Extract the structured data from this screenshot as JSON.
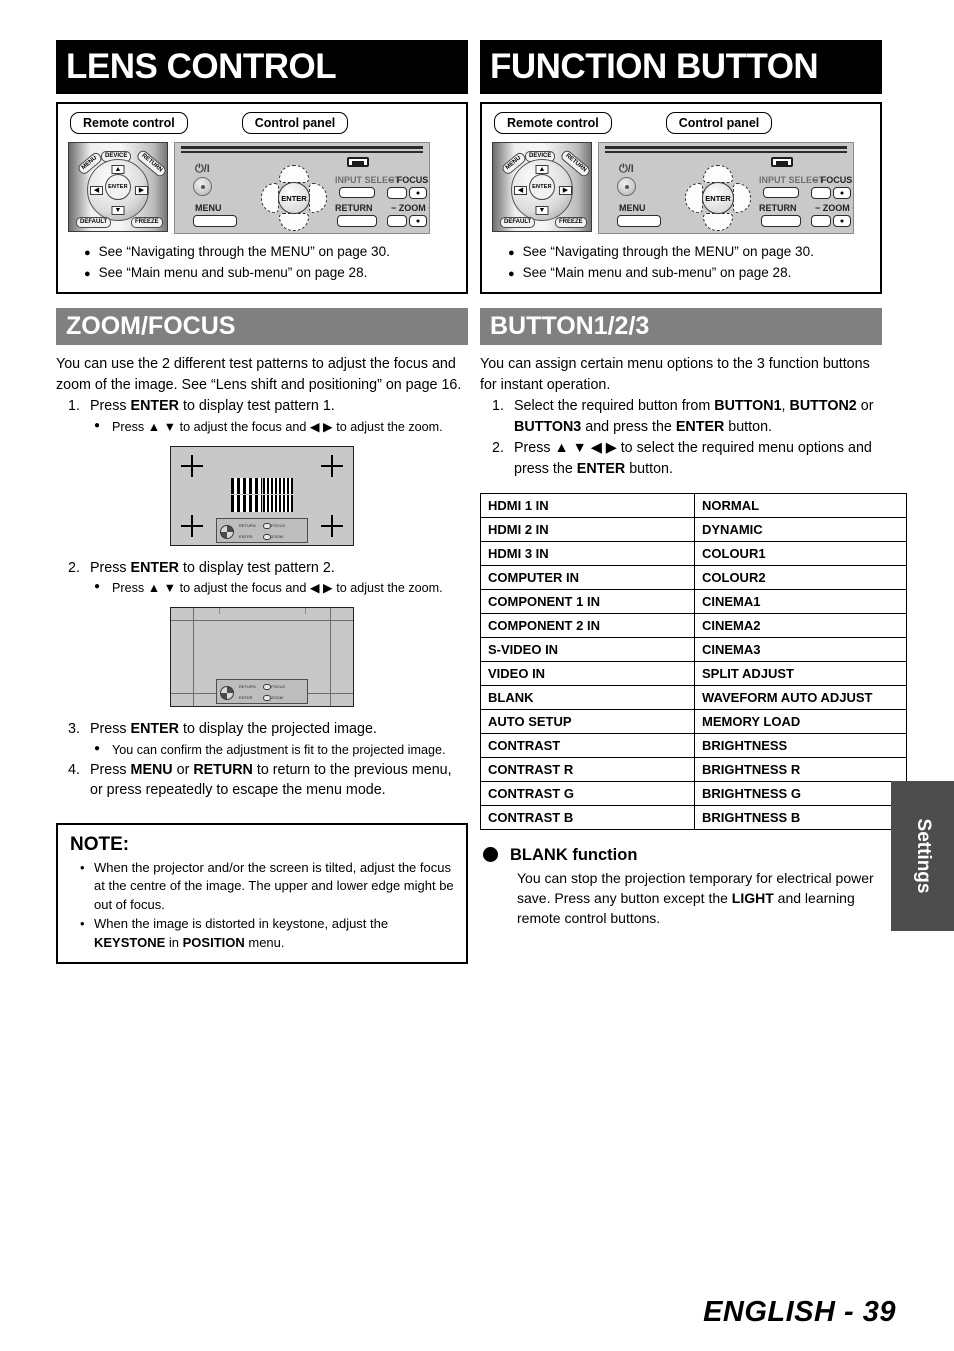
{
  "page": {
    "footer": "ENGLISH - 39",
    "side_tab": "Settings"
  },
  "left_column": {
    "section_title": "LENS CONTROL",
    "device_panel": {
      "remote_label": "Remote control",
      "panel_label": "Control panel",
      "remote": {
        "device": "DEVICE",
        "menu": "MENU",
        "return": "RETURN",
        "enter": "ENTER",
        "default": "DEFAULT",
        "freeze": "FREEZE",
        "up": "▲",
        "down": "▼",
        "left": "◀",
        "right": "▶"
      },
      "control_panel": {
        "power": "⏻/I",
        "input_select": "INPUT SELECT",
        "focus": "− FOCUS +",
        "menu": "MENU",
        "return": "RETURN",
        "zoom": "− ZOOM +",
        "enter": "ENTER"
      },
      "references": [
        "See “Navigating through the MENU” on page 30.",
        "See “Main menu and sub-menu” on page 28."
      ]
    },
    "sub_section_title": "ZOOM/FOCUS",
    "intro": "You can use the 2 different test patterns to adjust the focus and zoom of the image. See “Lens shift and positioning” on page 16.",
    "step1_num": "1.",
    "step1_pre": "Press ",
    "step1_bold": "ENTER",
    "step1_post": " to display test pattern 1.",
    "step1_bullet": "Press ▲ ▼ to adjust the focus and ◀ ▶ to adjust the zoom.",
    "step2_num": "2.",
    "step2_pre": "Press ",
    "step2_bold": "ENTER",
    "step2_post": " to display test pattern 2.",
    "step2_bullet": "Press ▲ ▼ to adjust the focus and ◀ ▶ to adjust the zoom.",
    "step3_num": "3.",
    "step3_pre": "Press ",
    "step3_bold": "ENTER",
    "step3_post": " to display the projected image.",
    "step3_bullet": "You can confirm the adjustment is fit to the projected image.",
    "step4_num": "4.",
    "step4_pre": "Press ",
    "step4_bold1": "MENU",
    "step4_mid": " or ",
    "step4_bold2": "RETURN",
    "step4_post": " to return to the previous menu, or press repeatedly to escape the menu mode.",
    "pattern_legend": {
      "return": "RETURN",
      "focus": "FOCUS",
      "enter": "ENTER",
      "zoom": "ZOOM"
    },
    "note": {
      "title": "NOTE:",
      "item1": "When the projector and/or the screen is tilted, adjust the focus at the centre of the image. The upper and lower edge might be out of focus.",
      "item2_pre": "When the image is distorted in keystone, adjust the ",
      "item2_bold1": "KEYSTONE",
      "item2_mid": " in ",
      "item2_bold2": "POSITION",
      "item2_post": " menu."
    }
  },
  "right_column": {
    "section_title": "FUNCTION BUTTON",
    "device_panel": {
      "remote_label": "Remote control",
      "panel_label": "Control panel",
      "references": [
        "See “Navigating through the MENU” on page 30.",
        "See “Main menu and sub-menu” on page 28."
      ]
    },
    "sub_section_title": "BUTTON1/2/3",
    "intro": "You can assign certain menu options to the 3 function buttons for instant operation.",
    "step1_num": "1.",
    "step1_a": "Select the required button from ",
    "step1_b1": "BUTTON1",
    "step1_b": ", ",
    "step1_b2": "BUTTON2",
    "step1_c": " or ",
    "step1_b3": "BUTTON3",
    "step1_d": " and press the ",
    "step1_b4": "ENTER",
    "step1_e": " button.",
    "step2_num": "2.",
    "step2_a": "Press ▲ ▼ ◀ ▶ to select the required menu options and press the ",
    "step2_b1": "ENTER",
    "step2_c": " button.",
    "options_table": [
      [
        "HDMI 1 IN",
        "NORMAL"
      ],
      [
        "HDMI 2 IN",
        "DYNAMIC"
      ],
      [
        "HDMI 3 IN",
        "COLOUR1"
      ],
      [
        "COMPUTER IN",
        "COLOUR2"
      ],
      [
        "COMPONENT 1 IN",
        "CINEMA1"
      ],
      [
        "COMPONENT 2 IN",
        "CINEMA2"
      ],
      [
        "S-VIDEO IN",
        "CINEMA3"
      ],
      [
        "VIDEO IN",
        "SPLIT ADJUST"
      ],
      [
        "BLANK",
        "WAVEFORM AUTO ADJUST"
      ],
      [
        "AUTO SETUP",
        "MEMORY LOAD"
      ],
      [
        "CONTRAST",
        "BRIGHTNESS"
      ],
      [
        "CONTRAST R",
        "BRIGHTNESS R"
      ],
      [
        "CONTRAST G",
        "BRIGHTNESS G"
      ],
      [
        "CONTRAST B",
        "BRIGHTNESS B"
      ]
    ],
    "blank_function": {
      "title": "BLANK function",
      "body_pre": "You can stop the projection temporary for electrical power save. Press any button except the ",
      "body_bold": "LIGHT",
      "body_post": " and learning remote control buttons."
    }
  }
}
